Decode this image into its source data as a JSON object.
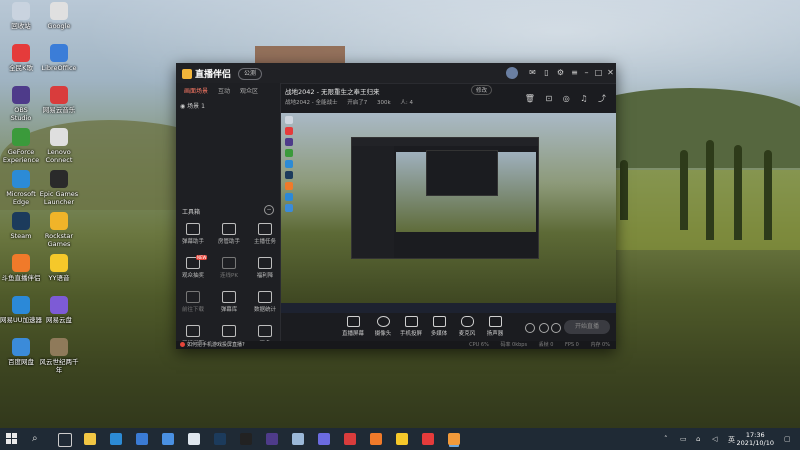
{
  "desktop": {
    "icons": [
      {
        "label": "回收站",
        "color": "#c9d3df"
      },
      {
        "label": "Google",
        "color": "#e0e0e0"
      },
      {
        "label": "全民K歌",
        "color": "#e53b3b"
      },
      {
        "label": "LibreOffice",
        "color": "#3b7dd8"
      },
      {
        "label": "OBS\nStudio",
        "color": "#4e3b8a"
      },
      {
        "label": "网易云音乐",
        "color": "#d93c3c"
      },
      {
        "label": "GeForce\nExperience",
        "color": "#3b9a3b"
      },
      {
        "label": "Lenovo\nConnect",
        "color": "#dfdfdf"
      },
      {
        "label": "Microsoft\nEdge",
        "color": "#2c8bd6"
      },
      {
        "label": "Epic Games\nLauncher",
        "color": "#2a2a2a"
      },
      {
        "label": "Steam",
        "color": "#1c3b5c"
      },
      {
        "label": "Rockstar\nGames",
        "color": "#f0b429"
      },
      {
        "label": "斗鱼直播伴侣",
        "color": "#f07a2a"
      },
      {
        "label": "YY语音",
        "color": "#f5c82a"
      },
      {
        "label": "网易UU加速器",
        "color": "#2b89d8"
      },
      {
        "label": "网易云盘",
        "color": "#7d5bd6"
      },
      {
        "label": "百度网盘",
        "color": "#3b8bd9"
      },
      {
        "label": "风云世纪两千年",
        "color": "#8f7a5a"
      }
    ]
  },
  "app": {
    "title": "直播伴侣",
    "title_badge": "公测",
    "sidebar_tabs": [
      "画面场景",
      "互动",
      "观众区"
    ],
    "scene": "场景 1",
    "tools_title": "工具箱",
    "tools": [
      {
        "label": "弹幕助手"
      },
      {
        "label": "房管助手"
      },
      {
        "label": "主播任务"
      },
      {
        "label": "观众抽奖",
        "badge": "NEW"
      },
      {
        "label": "连线PK",
        "dim": true
      },
      {
        "label": "福利降"
      },
      {
        "label": "前往下载",
        "dim": true
      },
      {
        "label": "弹幕库"
      },
      {
        "label": "数据统计"
      },
      {
        "label": "开播提醒"
      },
      {
        "label": "···"
      },
      {
        "label": "更多"
      }
    ],
    "stream_title": "战地2042 - 无限重生之奉王归来",
    "edit_label": "修改",
    "meta": [
      "战地2042 - 全能战士",
      "开启了7",
      "300k",
      "人: 4"
    ],
    "header_icons": [
      "delete-icon",
      "lock-icon",
      "camera-icon",
      "bell-icon",
      "share-icon"
    ],
    "controls": [
      "直播屏幕",
      "摄像头",
      "手机投屏",
      "多媒体",
      "麦克风",
      "扬声器"
    ],
    "go_live": "开始直播",
    "notice": "如何把手机游戏投屏直播?",
    "stats": [
      "CPU 6%",
      "码率 0kbps",
      "丢帧 0",
      "FPS 0",
      "内存 0%"
    ]
  },
  "taskbar": {
    "time": "17:36",
    "date": "2021/10/10",
    "apps": [
      "explorer",
      "edge",
      "store",
      "mail",
      "dell",
      "steam",
      "epic",
      "obs",
      "network",
      "qq",
      "netease",
      "douyu",
      "yy",
      "record",
      "app"
    ]
  }
}
